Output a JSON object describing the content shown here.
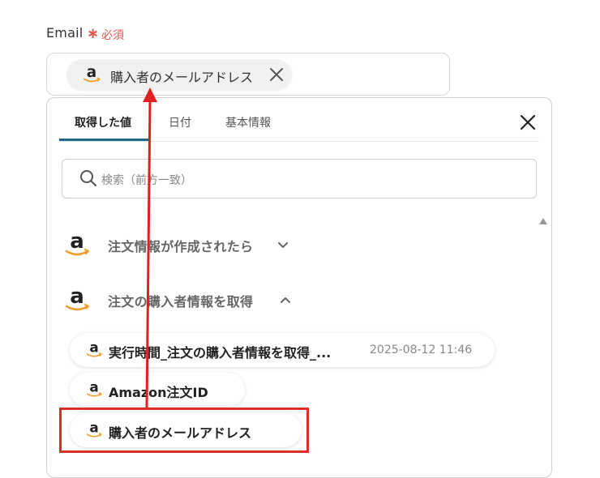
{
  "field": {
    "label": "Email",
    "required_mark": "∗",
    "required_text": "必須"
  },
  "chip": {
    "label": "購入者のメールアドレス"
  },
  "tabs": [
    {
      "label": "取得した値",
      "active": true
    },
    {
      "label": "日付",
      "active": false
    },
    {
      "label": "基本情報",
      "active": false
    }
  ],
  "search": {
    "placeholder": "検索（前方一致）"
  },
  "groups": [
    {
      "title": "注文情報が作成されたら",
      "expanded": false
    },
    {
      "title": "注文の購入者情報を取得",
      "expanded": true
    }
  ],
  "items": [
    {
      "label": "実行時間_注文の購入者情報を取得_...",
      "meta": "2025-08-12 11:46"
    },
    {
      "label": "Amazon注文ID",
      "meta": ""
    },
    {
      "label": "購入者のメールアドレス",
      "meta": ""
    }
  ],
  "icons": {
    "brand": "amazon-icon",
    "close": "close-icon",
    "search": "search-icon",
    "chevron_down": "chevron-down-icon",
    "chevron_up": "chevron-up-icon"
  },
  "colors": {
    "required": "#e8554e",
    "tab_active": "#1f6a7e",
    "highlight": "#d9302a",
    "arrow": "#e02020",
    "amazon_smile": "#f0a030"
  }
}
